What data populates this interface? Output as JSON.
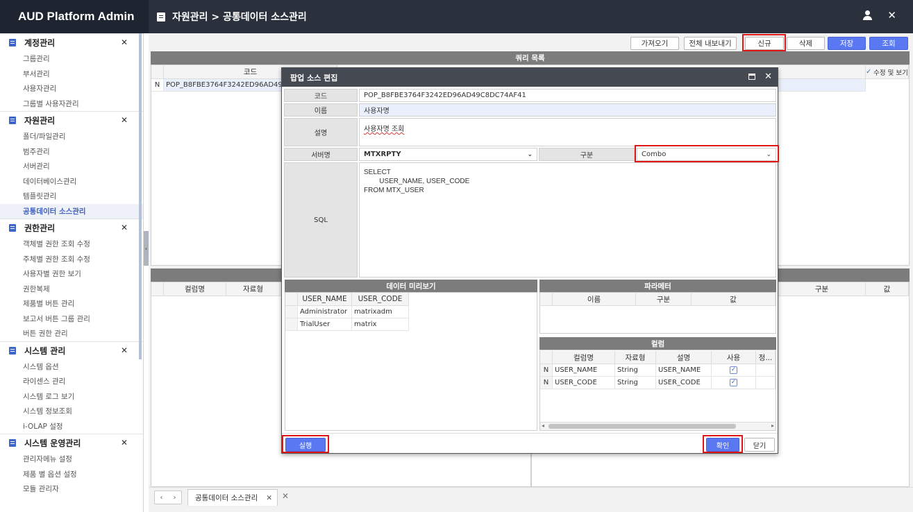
{
  "app": {
    "title": "AUD Platform Admin"
  },
  "header": {
    "breadcrumb": "자원관리 > 공통데이터 소스관리"
  },
  "sidebar": {
    "sections": [
      {
        "title": "계정관리",
        "items": [
          "그룹관리",
          "부서관리",
          "사용자관리",
          "그룹별 사용자관리"
        ]
      },
      {
        "title": "자원관리",
        "items": [
          "폴더/파일관리",
          "범주관리",
          "서버관리",
          "데이터베이스관리",
          "템플릿관리",
          "공통데이터 소스관리"
        ]
      },
      {
        "title": "권한관리",
        "items": [
          "객체별 권한 조회 수정",
          "주체별 권한 조회 수정",
          "사용자별 권한 보기",
          "권한복제",
          "제품별 버튼 관리",
          "보고서 버튼 그룹 관리",
          "버튼 권한 관리"
        ]
      },
      {
        "title": "시스템 관리",
        "items": [
          "시스템 옵션",
          "라이센스 관리",
          "시스템 로그 보기",
          "시스템 정보조회",
          "i-OLAP 설정"
        ]
      },
      {
        "title": "시스템 운영관리",
        "items": [
          "관리자메뉴 설정",
          "제품 별 옵션 설정",
          "모듈 관리자"
        ]
      }
    ],
    "active_item": "공통데이터 소스관리",
    "close_glyph": "✕"
  },
  "toolbar": {
    "import": "가져오기",
    "export_all": "전체 내보내기",
    "new": "신규",
    "delete": "삭제",
    "save": "저장",
    "search": "조회"
  },
  "query_list": {
    "title": "쿼리 목록",
    "col_code": "코드",
    "col_edit_view": "수정 및 보기",
    "row_flag": "N",
    "row_code": "POP_B8FBE3764F3242ED96AD49C8DC74AF41"
  },
  "lower_left": {
    "cols": [
      "컬럼명",
      "자료형"
    ]
  },
  "lower_right": {
    "cols": [
      "구분",
      "값"
    ]
  },
  "dialog": {
    "title": "팝업 소스 편집",
    "code_label": "코드",
    "code_value": "POP_B8FBE3764F3242ED96AD49C8DC74AF41",
    "name_label": "이름",
    "name_value": "사용자명",
    "desc_label": "설명",
    "desc_value": "사용자명 조회",
    "server_label": "서버명",
    "server_value": "MTXRPTY",
    "type_label": "구분",
    "type_value": "Combo",
    "sql_label": "SQL",
    "sql_value": "SELECT\n        USER_NAME, USER_CODE\nFROM MTX_USER",
    "preview": {
      "title": "데이터 미리보기",
      "headers": [
        "USER_NAME",
        "USER_CODE"
      ],
      "rows": [
        [
          "Administrator",
          "matrixadm"
        ],
        [
          "TrialUser",
          "matrix"
        ]
      ]
    },
    "params": {
      "title": "파라메터",
      "headers": [
        "이름",
        "구분",
        "값"
      ]
    },
    "columns": {
      "title": "컬럼",
      "headers": [
        "컬럼명",
        "자료형",
        "설명",
        "사용",
        "정..."
      ],
      "rows": [
        {
          "flag": "N",
          "name": "USER_NAME",
          "type": "String",
          "desc": "USER_NAME",
          "use": true
        },
        {
          "flag": "N",
          "name": "USER_CODE",
          "type": "String",
          "desc": "USER_CODE",
          "use": true
        }
      ]
    },
    "run": "실행",
    "ok": "확인",
    "close": "닫기"
  },
  "bottom_tab": {
    "label": "공통데이터 소스관리"
  },
  "colors": {
    "brand_bg": "#1f2530",
    "header_bg": "#2b313c",
    "accent": "#5a78f2",
    "highlight": "#e01515"
  }
}
